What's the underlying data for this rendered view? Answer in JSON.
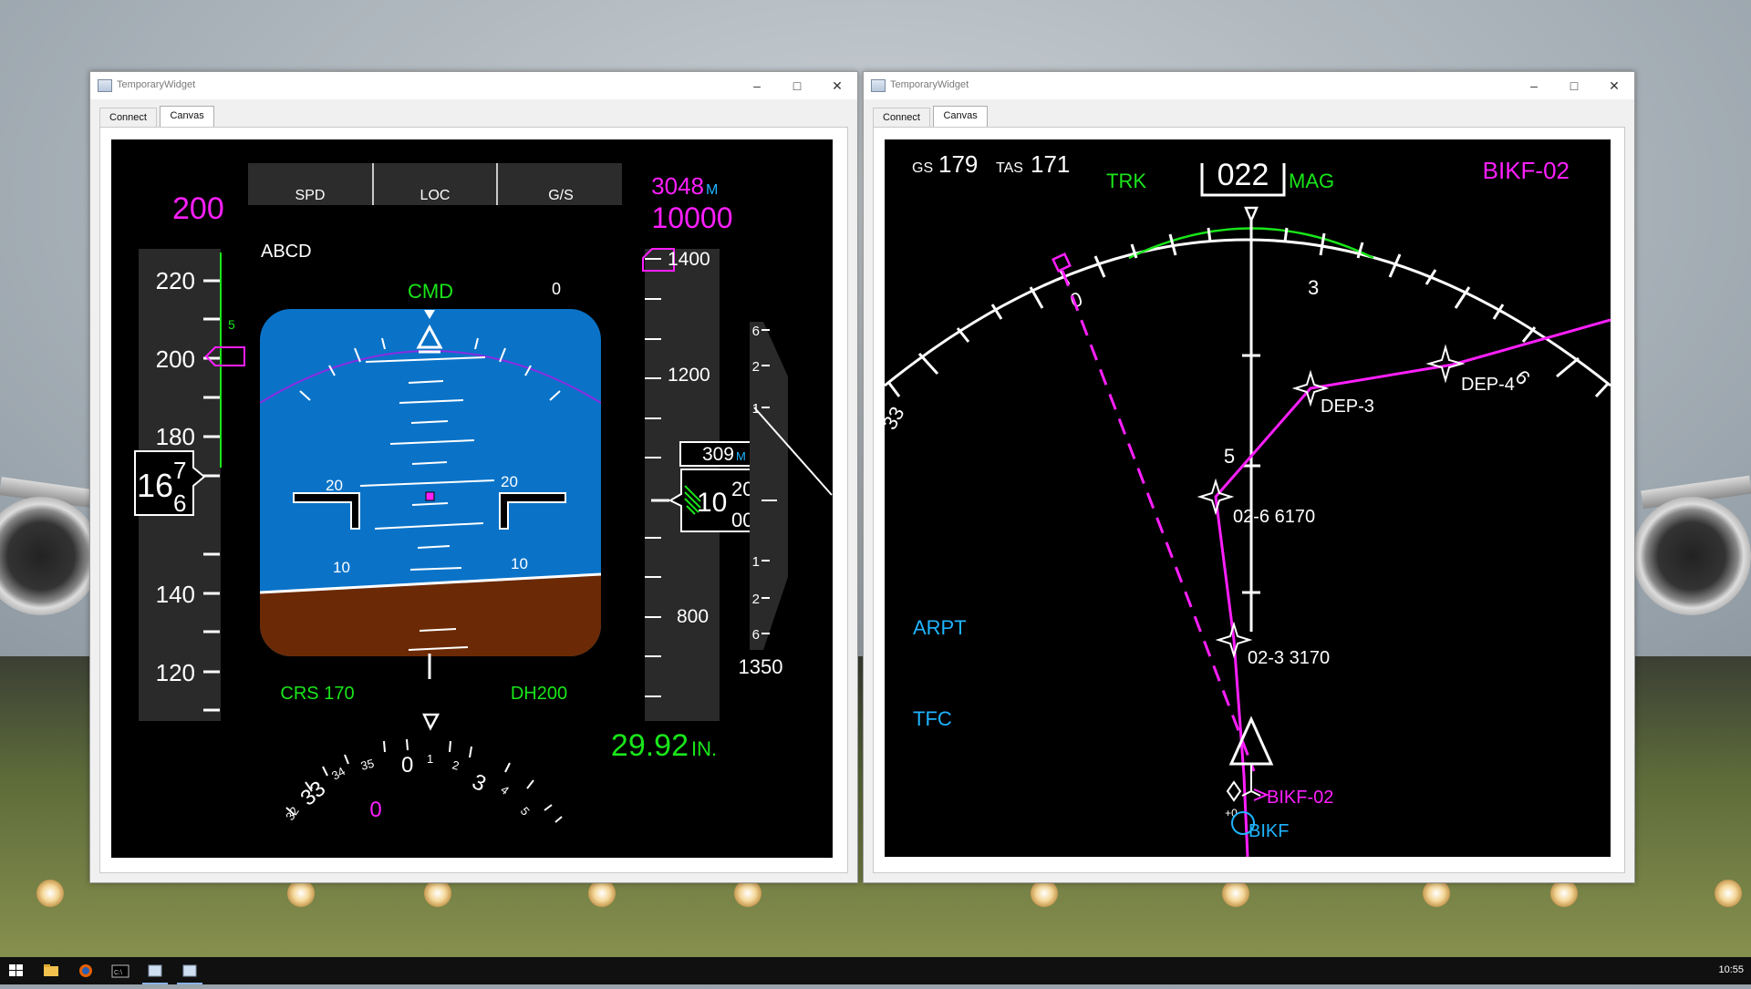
{
  "windows": [
    {
      "title": "TemporaryWidget",
      "tabs": [
        "Connect",
        "Canvas"
      ],
      "active_tab": "Canvas"
    },
    {
      "title": "TemporaryWidget",
      "tabs": [
        "Connect",
        "Canvas"
      ],
      "active_tab": "Canvas"
    }
  ],
  "pfd": {
    "selected_speed": "200",
    "fma": [
      "SPD",
      "LOC",
      "G/S"
    ],
    "identifier": "ABCD",
    "ap_status": "CMD",
    "target_alt_m": "3048",
    "target_alt_m_unit": "M",
    "target_alt_ft": "10000",
    "speed_ticks": [
      "220",
      "200",
      "180",
      "140",
      "120"
    ],
    "speed_trend_5": "5",
    "current_speed_main": "16",
    "current_speed_roll_top": "7",
    "current_speed_roll_bottom": "6",
    "bank_value": "0",
    "pitch_labels": [
      "20",
      "20",
      "10",
      "10",
      "10"
    ],
    "alt_ticks": [
      "1400",
      "1200",
      "800"
    ],
    "current_alt_m": "309",
    "current_alt_m_unit": "M",
    "current_alt_main": "10",
    "current_alt_roll_top": "20",
    "current_alt_roll_bottom": "00",
    "vs_ticks": [
      "6",
      "2",
      "1",
      "1",
      "2",
      "6"
    ],
    "vs_value": "1350",
    "crs": "CRS 170",
    "dh": "DH200",
    "baro": "29.92",
    "baro_unit": "IN.",
    "heading_labels": [
      "32",
      "33",
      "34",
      "35",
      "0",
      "1",
      "2",
      "3",
      "4",
      "5"
    ],
    "heading_bug": "0"
  },
  "nd": {
    "gs_label": "GS",
    "gs": "179",
    "tas_label": "TAS",
    "tas": "171",
    "trk_label": "TRK",
    "track": "022",
    "mag_label": "MAG",
    "active_wpt": "BIKF-02",
    "compass_labels": [
      "33",
      "0",
      "3",
      "6"
    ],
    "range_label": "5",
    "waypoints": [
      {
        "name": "DEP-3"
      },
      {
        "name": "DEP-4"
      },
      {
        "name": "02-6 6170"
      },
      {
        "name": "02-3 3170"
      },
      {
        "name": "BIKF-02"
      },
      {
        "name": "BIKF"
      }
    ],
    "arpt": "ARPT",
    "tfc": "TFC",
    "offset": "+0"
  },
  "taskbar": {
    "clock": "10:55"
  },
  "colors": {
    "magenta": "#ff1fff",
    "green": "#19e619",
    "cyan": "#1fb4ff",
    "sky": "#0a73c8",
    "ground": "#6b2a05"
  }
}
